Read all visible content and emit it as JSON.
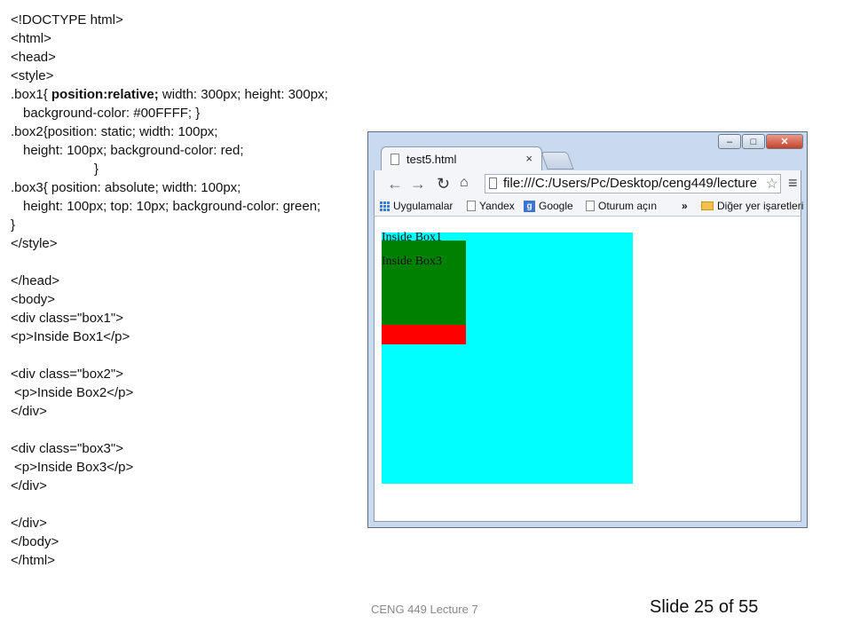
{
  "code": {
    "lines": [
      "<!DOCTYPE html>",
      "<html>",
      "<head>",
      "<style>",
      ".box1{ position:relative; width: 300px; height: 300px;",
      "background-color: #00FFFF; }",
      ".box2{position: static; width: 100px;",
      "height: 100px; background-color: red;",
      "}",
      ".box3{ position: absolute; width: 100px;",
      "height: 100px; top: 10px; background-color: green;",
      "}",
      "</style>",
      "</head>",
      "<body>",
      "<div class=\"box1\">",
      "<p>Inside Box1</p>",
      "<div class=\"box2\">",
      "<p>Inside Box2</p>",
      "</div>",
      "<div class=\"box3\">",
      "<p>Inside Box3</p>",
      "</div>",
      "</div>",
      "</body>",
      "</html>"
    ]
  },
  "browser": {
    "tab_title": "test5.html",
    "tab_close": "×",
    "address": "file:///C:/Users/Pc/Desktop/ceng449/lecture",
    "window_controls": [
      "–",
      "□",
      "✕"
    ],
    "bookmarks": [
      "Uygulamalar",
      "Yandex",
      "Google",
      "Oturum açın",
      "»",
      "Diğer yer işaretleri"
    ],
    "page": {
      "box1_text": "Inside Box1",
      "box3_text": "Inside Box3",
      "box1_color": "#00FFFF",
      "box2_color": "#FF0000",
      "box3_color": "#008000"
    }
  },
  "footer": {
    "center": "CENG 449 Lecture 7",
    "right": "Slide 25 of 55"
  }
}
